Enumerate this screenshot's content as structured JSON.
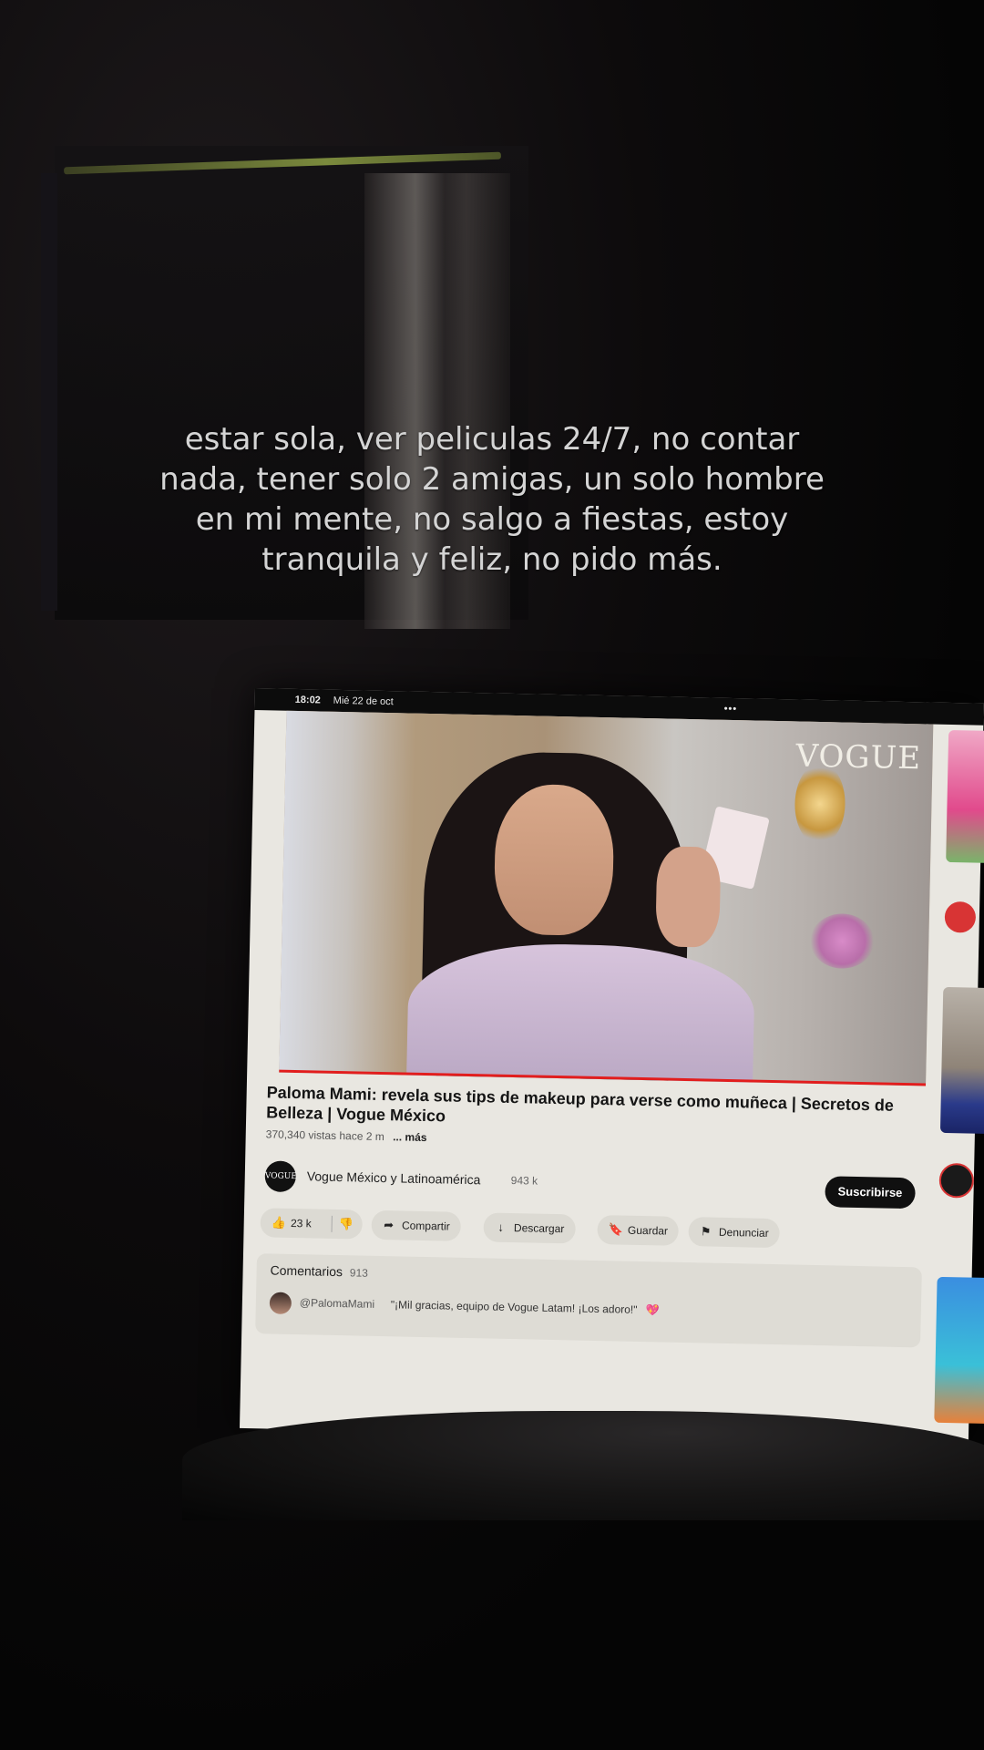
{
  "caption": {
    "text": "estar sola, ver peliculas 24/7, no contar nada, tener solo 2 amigas, un solo hombre en mi mente, no salgo a fiestas, estoy tranquila y feliz, no pido más."
  },
  "status_bar": {
    "time": "18:02",
    "date": "Mié 22 de oct",
    "dots": "•••"
  },
  "video": {
    "logo": "VOGUE",
    "title": "Paloma Mami: revela sus tips de makeup para verse como muñeca | Secretos de Belleza | Vogue México",
    "views": "370,340 vistas",
    "age": "hace 2 m",
    "more": "... más"
  },
  "channel": {
    "avatar_text": "VOGUE",
    "name": "Vogue México y Latinoamérica",
    "subscribers": "943 k",
    "subscribe_label": "Suscribirse"
  },
  "actions": {
    "like_count": "23 k",
    "share_label": "Compartir",
    "download_label": "Descargar",
    "save_label": "Guardar",
    "report_label": "Denunciar"
  },
  "comments": {
    "header": "Comentarios",
    "count": "913",
    "top_comment": {
      "author": "@PalomaMami",
      "text": "\"¡Mil gracias, equipo de Vogue Latam! ¡Los adoro!\""
    }
  },
  "icons": {
    "like": "👍",
    "dislike": "👎",
    "share": "➦",
    "download": "↓",
    "save": "🔖",
    "report": "⚑",
    "heart": "💖"
  }
}
